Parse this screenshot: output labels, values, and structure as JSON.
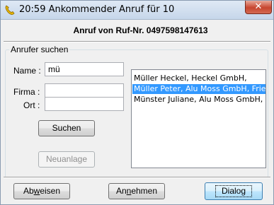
{
  "window": {
    "title": "20:59 Ankommender Anruf für 10",
    "close_glyph": "✕"
  },
  "header": {
    "caller_text": "Anruf von Ruf-Nr. 0497598147613"
  },
  "search": {
    "group_title": "Anrufer suchen",
    "name_label": "Name :",
    "name_value": "mü",
    "company_label": "Firma :",
    "company_value": "",
    "city_label": "Ort :",
    "city_value": "",
    "search_button": "Suchen",
    "new_button": "Neuanlage"
  },
  "results": {
    "items": [
      {
        "label": "Müller Heckel, Heckel GmbH,",
        "selected": false
      },
      {
        "label": "Müller Peter, Alu Moss GmbH, Friedrichshafen",
        "selected": true
      },
      {
        "label": "Münster Juliane, Alu Moss GmbH, Weingarten",
        "selected": false
      }
    ]
  },
  "footer": {
    "reject_prefix": "Ab",
    "reject_mnemonic": "w",
    "reject_suffix": "eisen",
    "accept_prefix": "An",
    "accept_mnemonic": "n",
    "accept_suffix": "ehmen",
    "dialog_label": "Dialog"
  }
}
